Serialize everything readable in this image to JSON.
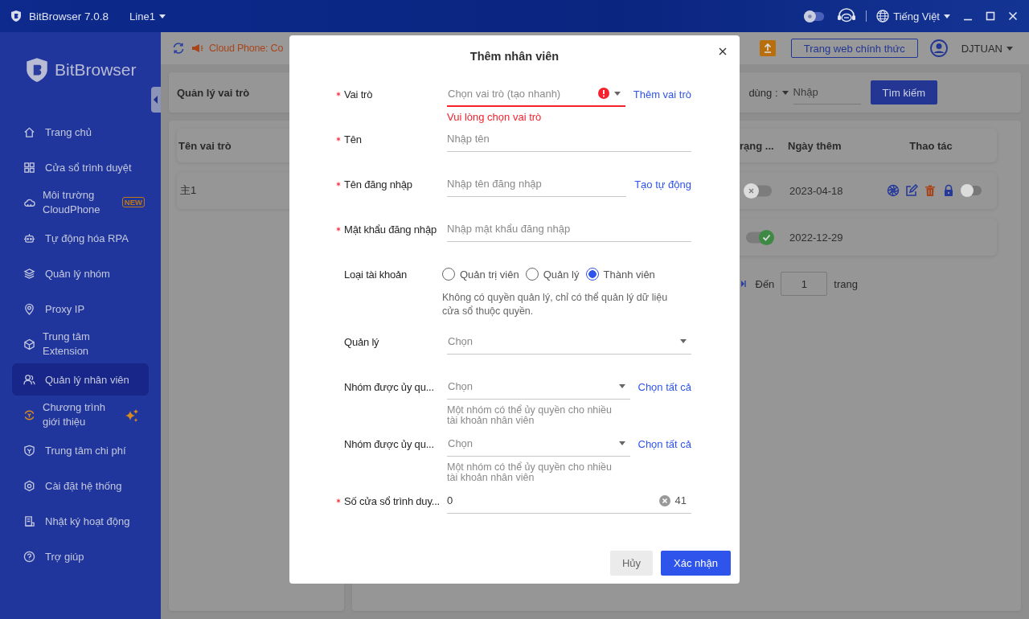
{
  "title_bar": {
    "app_name": "BitBrowser 7.0.8",
    "line": "Line1",
    "language": "Tiếng Việt"
  },
  "sidebar": {
    "brand": "BitBrowser",
    "items": [
      {
        "label": "Trang chủ",
        "selected": false
      },
      {
        "label": "Cửa sổ trình duyệt",
        "selected": false
      },
      {
        "label": "Môi trường\nCloudPhone",
        "selected": false,
        "badge": "NEW"
      },
      {
        "label": "Tự động hóa RPA",
        "selected": false
      },
      {
        "label": "Quản lý nhóm",
        "selected": false
      },
      {
        "label": "Proxy IP",
        "selected": false
      },
      {
        "label": "Trung tâm\nExtension",
        "selected": false
      },
      {
        "label": "Quản lý nhân viên",
        "selected": true
      },
      {
        "label": "Chương trình\ngiới thiệu",
        "selected": false,
        "sparkle": true
      },
      {
        "label": "Trung tâm chi phí",
        "selected": false
      },
      {
        "label": "Cài đặt hệ thống",
        "selected": false
      },
      {
        "label": "Nhật ký hoạt động",
        "selected": false
      },
      {
        "label": "Trợ giúp",
        "selected": false
      }
    ]
  },
  "header": {
    "notice": "Cloud Phone: Co",
    "website_button": "Trang web chính thức",
    "user": "DJTUAN"
  },
  "filter": {
    "title": "Quản lý vai trò",
    "field_label": "dùng :",
    "placeholder": "Nhập",
    "search_button": "Tìm kiếm"
  },
  "roles": {
    "column": "Tên vai trò",
    "rows": [
      {
        "name": "主1"
      }
    ]
  },
  "table": {
    "columns": [
      "rạng ...",
      "Ngày thêm",
      "Thao tác"
    ],
    "rows": [
      {
        "enabled": false,
        "date": "2023-04-18",
        "actions": {
          "switch_on": false
        }
      },
      {
        "enabled": true,
        "date": "2022-12-29"
      }
    ]
  },
  "pagination": {
    "goto_label": "Đến",
    "page": "1",
    "page_suffix": "trang"
  },
  "dialog": {
    "title": "Thêm nhân viên",
    "fields": [
      {
        "kind": "select",
        "label": "Vai trò",
        "required": true,
        "placeholder": "Chọn vai trò (tạo nhanh)",
        "link": "Thêm vai trò",
        "error": "Vui lòng chọn vai trò"
      },
      {
        "kind": "input",
        "label": "Tên",
        "required": true,
        "placeholder": "Nhập tên"
      },
      {
        "kind": "input",
        "label": "Tên đăng nhập",
        "required": true,
        "placeholder": "Nhập tên đăng nhập",
        "link": "Tạo tự động"
      },
      {
        "kind": "input",
        "label": "Mật khẩu đăng nhập",
        "required": true,
        "placeholder": "Nhập mật khẩu đăng nhập"
      },
      {
        "kind": "radio",
        "label": "Loại tài khoản",
        "required": false,
        "options": [
          {
            "label": "Quản trị viên",
            "selected": false
          },
          {
            "label": "Quản lý",
            "selected": false
          },
          {
            "label": "Thành viên",
            "selected": true
          }
        ],
        "hint": "Không có quyền quản lý, chỉ có thể quản lý dữ liệu cửa sổ thuộc quyền."
      },
      {
        "kind": "select",
        "label": "Quản lý",
        "required": false,
        "placeholder": "Chọn"
      },
      {
        "kind": "select",
        "label": "Nhóm được ủy qu...",
        "required": false,
        "placeholder": "Chọn",
        "link": "Chọn tất cả",
        "hint": "Một nhóm có thể ủy quyền cho nhiều tài khoản nhân viên"
      },
      {
        "kind": "select",
        "label": "Nhóm được ủy qu...",
        "required": false,
        "placeholder": "Chọn",
        "link": "Chọn tất cả",
        "hint": "Một nhóm có thể ủy quyền cho nhiều tài khoản nhân viên"
      },
      {
        "kind": "number",
        "label": "Số cửa sổ trình duy...",
        "required": true,
        "value": "0",
        "suffix": "41"
      }
    ],
    "cancel": "Hủy",
    "confirm": "Xác nhận"
  }
}
